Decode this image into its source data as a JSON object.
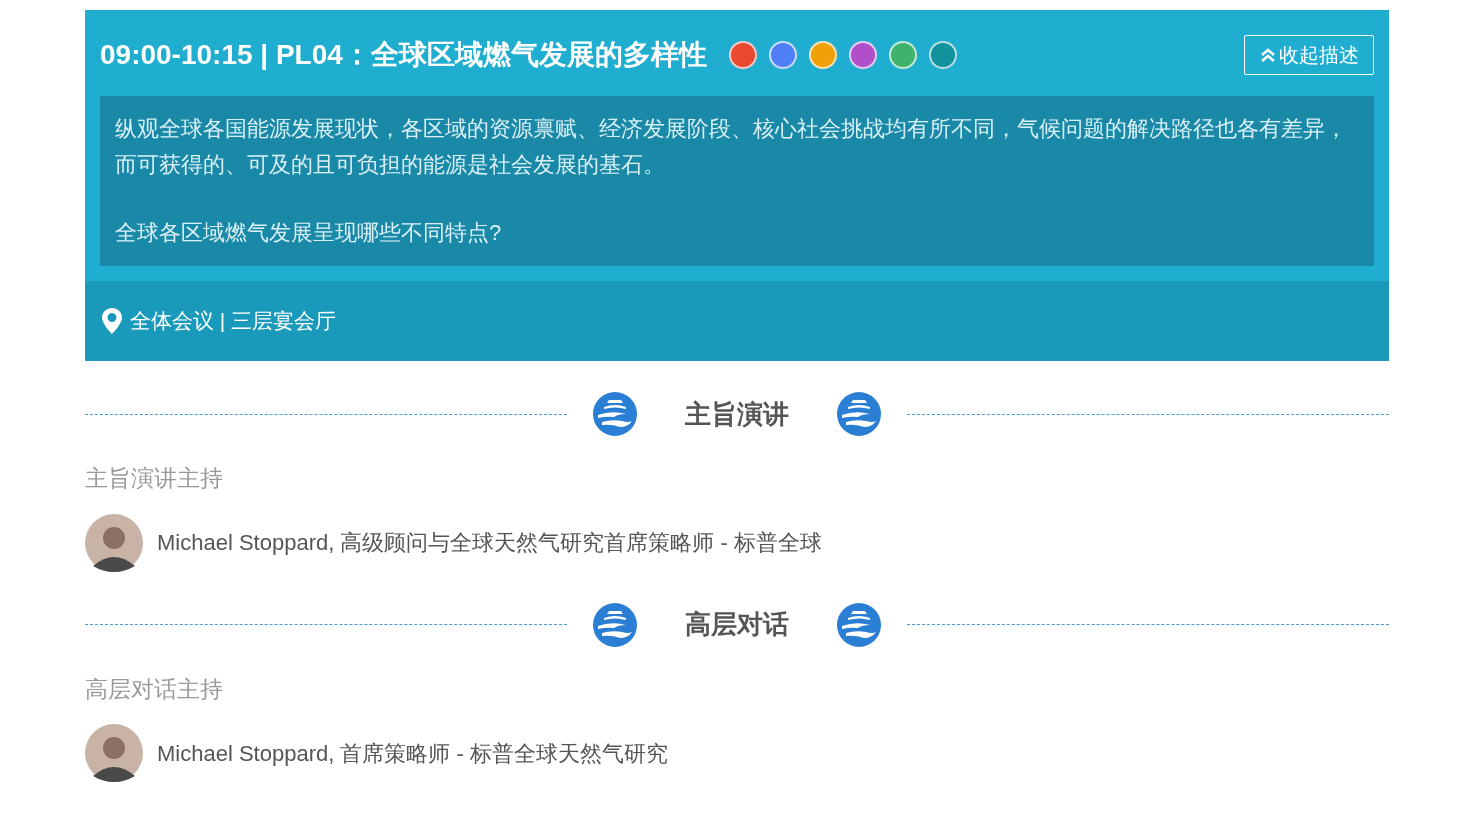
{
  "session": {
    "title": "09:00-10:15 | PL04：全球区域燃气发展的多样性",
    "tags": [
      {
        "color": "#e8492f"
      },
      {
        "color": "#4f7ff6"
      },
      {
        "color": "#f0a10a"
      },
      {
        "color": "#b04fc8"
      },
      {
        "color": "#3fb36b"
      },
      {
        "color": "#12929c"
      }
    ],
    "toggle_button": "收起描述",
    "description": [
      "纵观全球各国能源发展现状，各区域的资源禀赋、经济发展阶段、核心社会挑战均有所不同，气候问题的解决路径也各有差异，而可获得的、可及的且可负担的能源是社会发展的基石。",
      "全球各区域燃气发展呈现哪些不同特点?"
    ],
    "location": "全体会议 | 三层宴会厅"
  },
  "sections": [
    {
      "heading": "主旨演讲",
      "role": "主旨演讲主持",
      "speakers": [
        {
          "text": "Michael Stoppard, 高级顾问与全球天然气研究首席策略师 - 标普全球"
        }
      ]
    },
    {
      "heading": "高层对话",
      "role": "高层对话主持",
      "speakers": [
        {
          "text": "Michael Stoppard, 首席策略师 - 标普全球天然气研究"
        }
      ]
    }
  ]
}
